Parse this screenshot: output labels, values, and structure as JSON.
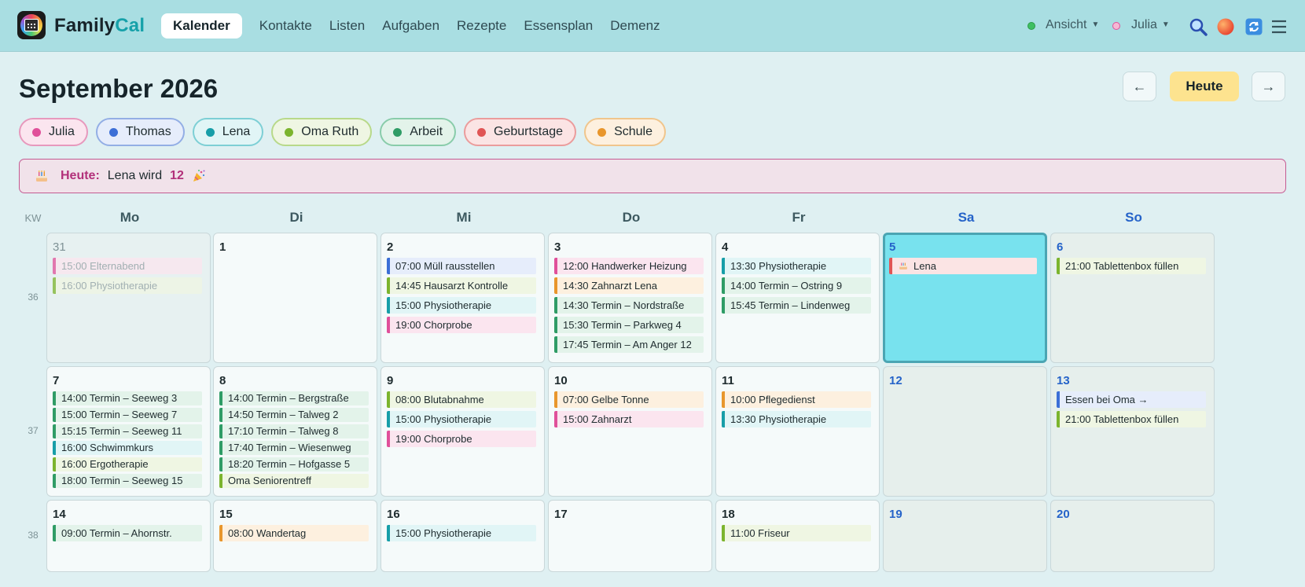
{
  "app": {
    "brand_part1": "Family",
    "brand_part2": "Cal"
  },
  "nav": [
    {
      "label": "Kalender",
      "active": true
    },
    {
      "label": "Kontakte"
    },
    {
      "label": "Listen"
    },
    {
      "label": "Aufgaben"
    },
    {
      "label": "Rezepte"
    },
    {
      "label": "Essensplan"
    },
    {
      "label": "Demenz"
    }
  ],
  "topright": {
    "view_label": "Ansicht",
    "user_label": "Julia",
    "icons": [
      "search-icon",
      "avatar-icon",
      "sync-icon",
      "menu-icon"
    ]
  },
  "header": {
    "month_title": "September 2026",
    "prev": "←",
    "today": "Heute",
    "next": "→"
  },
  "filters": [
    {
      "label": "Julia",
      "color": "#e0509a",
      "bg": "#fbe5ef",
      "border": "#e799bd"
    },
    {
      "label": "Thomas",
      "color": "#3c6fd6",
      "bg": "#e6edfb",
      "border": "#93aee5"
    },
    {
      "label": "Lena",
      "color": "#179ea8",
      "bg": "#e1f5f6",
      "border": "#7dcfd5"
    },
    {
      "label": "Oma Ruth",
      "color": "#7cb42e",
      "bg": "#eff6e3",
      "border": "#b8d98a"
    },
    {
      "label": "Arbeit",
      "color": "#2f9c66",
      "bg": "#e3f3ea",
      "border": "#89ccaa"
    },
    {
      "label": "Geburtstage",
      "color": "#e05555",
      "bg": "#fbe4e4",
      "border": "#eb9c9c"
    },
    {
      "label": "Schule",
      "color": "#e8962c",
      "bg": "#fdf0df",
      "border": "#f0c58c"
    }
  ],
  "banner": {
    "icon": "cake-icon",
    "label": "Heute:",
    "text": "Lena wird",
    "number": "12",
    "end_icon": "party-icon"
  },
  "calendar": {
    "kw_label": "KW",
    "weekdays": [
      "Mo",
      "Di",
      "Mi",
      "Do",
      "Fr",
      "Sa",
      "So"
    ],
    "weeks": [
      {
        "kw": "36",
        "days": [
          {
            "num": "31",
            "type": "other",
            "events": [
              {
                "text": "15:00 Elternabend",
                "cat": "Julia"
              },
              {
                "text": "16:00 Physiotherapie",
                "cat": "Oma Ruth"
              }
            ]
          },
          {
            "num": "1",
            "type": "normal",
            "events": []
          },
          {
            "num": "2",
            "type": "normal",
            "events": [
              {
                "text": "07:00 Müll rausstellen",
                "cat": "Thomas"
              },
              {
                "text": "14:45 Hausarzt Kontrolle",
                "cat": "Oma Ruth"
              },
              {
                "text": "15:00 Physiotherapie",
                "cat": "Lena"
              },
              {
                "text": "19:00 Chorprobe",
                "cat": "Julia"
              }
            ]
          },
          {
            "num": "3",
            "type": "normal",
            "events": [
              {
                "text": "12:00 Handwerker Heizung",
                "cat": "Julia"
              },
              {
                "text": "14:30 Zahnarzt Lena",
                "cat": "Schule"
              },
              {
                "text": "14:30 Termin – Nordstraße",
                "cat": "Arbeit"
              },
              {
                "text": "15:30 Termin – Parkweg 4",
                "cat": "Arbeit"
              },
              {
                "text": "17:45 Termin – Am Anger 12",
                "cat": "Arbeit"
              }
            ]
          },
          {
            "num": "4",
            "type": "normal",
            "events": [
              {
                "text": "13:30 Physiotherapie",
                "cat": "Lena"
              },
              {
                "text": "14:00 Termin – Ostring 9",
                "cat": "Arbeit"
              },
              {
                "text": "15:45 Termin – Lindenweg",
                "cat": "Arbeit"
              }
            ]
          },
          {
            "num": "5",
            "type": "today",
            "events": [
              {
                "text": "Lena",
                "cat": "Geburtstage",
                "icon": "cake-icon"
              }
            ]
          },
          {
            "num": "6",
            "type": "weekend",
            "events": [
              {
                "text": "21:00 Tablettenbox füllen",
                "cat": "Oma Ruth"
              }
            ]
          }
        ]
      },
      {
        "kw": "37",
        "days": [
          {
            "num": "7",
            "type": "normal",
            "dense": true,
            "events": [
              {
                "text": "14:00 Termin – Seeweg 3",
                "cat": "Arbeit"
              },
              {
                "text": "15:00 Termin – Seeweg 7",
                "cat": "Arbeit"
              },
              {
                "text": "15:15 Termin – Seeweg 11",
                "cat": "Arbeit"
              },
              {
                "text": "16:00 Schwimmkurs",
                "cat": "Lena"
              },
              {
                "text": "16:00 Ergotherapie",
                "cat": "Oma Ruth"
              },
              {
                "text": "18:00 Termin – Seeweg 15",
                "cat": "Arbeit"
              }
            ]
          },
          {
            "num": "8",
            "type": "normal",
            "dense": true,
            "events": [
              {
                "text": "14:00 Termin – Bergstraße",
                "cat": "Arbeit"
              },
              {
                "text": "14:50 Termin – Talweg 2",
                "cat": "Arbeit"
              },
              {
                "text": "17:10 Termin – Talweg 8",
                "cat": "Arbeit"
              },
              {
                "text": "17:40 Termin – Wiesenweg",
                "cat": "Arbeit"
              },
              {
                "text": "18:20 Termin – Hofgasse 5",
                "cat": "Arbeit"
              },
              {
                "text": "Oma Seniorentreff",
                "cat": "Oma Ruth"
              }
            ]
          },
          {
            "num": "9",
            "type": "normal",
            "events": [
              {
                "text": "08:00 Blutabnahme",
                "cat": "Oma Ruth"
              },
              {
                "text": "15:00 Physiotherapie",
                "cat": "Lena"
              },
              {
                "text": "19:00 Chorprobe",
                "cat": "Julia"
              }
            ]
          },
          {
            "num": "10",
            "type": "normal",
            "events": [
              {
                "text": "07:00 Gelbe Tonne",
                "cat": "Schule"
              },
              {
                "text": "15:00 Zahnarzt",
                "cat": "Julia"
              }
            ]
          },
          {
            "num": "11",
            "type": "normal",
            "events": [
              {
                "text": "10:00 Pflegedienst",
                "cat": "Schule"
              },
              {
                "text": "13:30 Physiotherapie",
                "cat": "Lena"
              }
            ]
          },
          {
            "num": "12",
            "type": "weekend",
            "events": []
          },
          {
            "num": "13",
            "type": "weekend",
            "events": [
              {
                "text": "Essen bei Oma →",
                "cat": "Thomas"
              },
              {
                "text": "21:00 Tablettenbox füllen",
                "cat": "Oma Ruth"
              }
            ]
          }
        ]
      },
      {
        "kw": "38",
        "days": [
          {
            "num": "14",
            "type": "normal",
            "events": [
              {
                "text": "09:00 Termin – Ahornstr.",
                "cat": "Arbeit"
              }
            ]
          },
          {
            "num": "15",
            "type": "normal",
            "events": [
              {
                "text": "08:00 Wandertag",
                "cat": "Schule"
              }
            ]
          },
          {
            "num": "16",
            "type": "normal",
            "events": [
              {
                "text": "15:00 Physiotherapie",
                "cat": "Lena"
              }
            ]
          },
          {
            "num": "17",
            "type": "normal",
            "events": []
          },
          {
            "num": "18",
            "type": "normal",
            "events": [
              {
                "text": "11:00 Friseur",
                "cat": "Oma Ruth"
              }
            ]
          },
          {
            "num": "19",
            "type": "weekend",
            "events": []
          },
          {
            "num": "20",
            "type": "weekend",
            "events": []
          }
        ]
      }
    ]
  }
}
